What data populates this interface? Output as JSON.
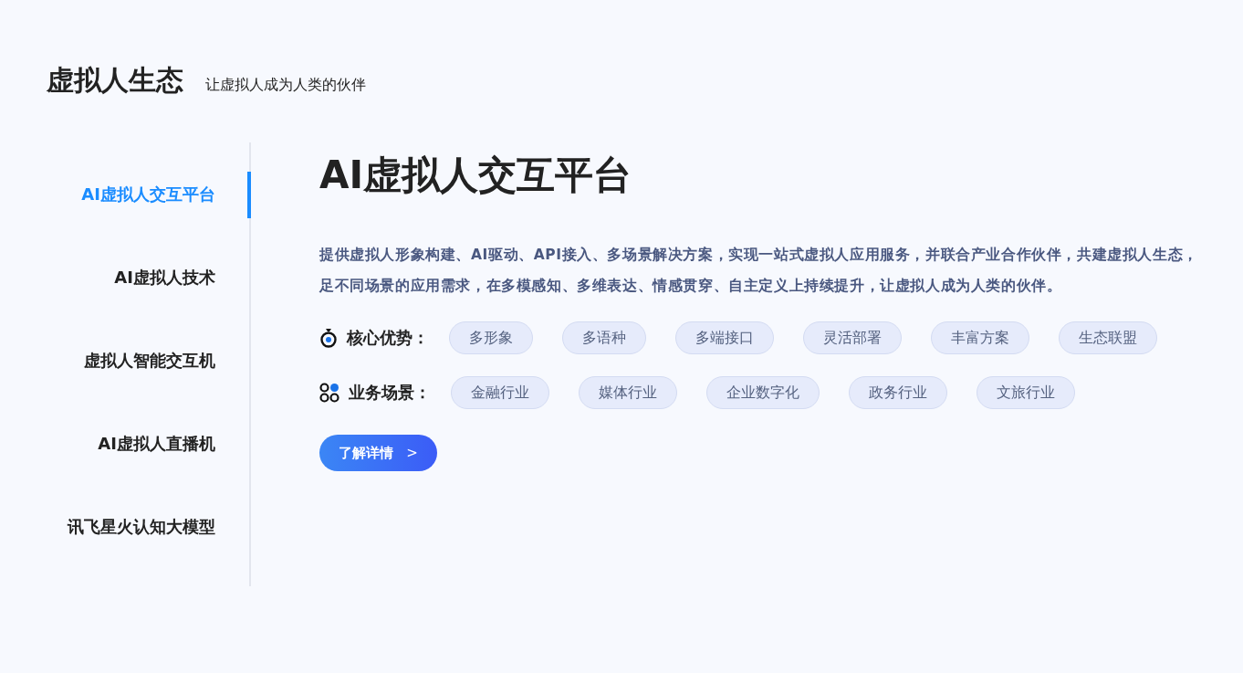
{
  "header": {
    "title": "虚拟人生态",
    "subtitle": "让虚拟人成为人类的伙伴"
  },
  "sidebar": {
    "items": [
      {
        "label": "AI虚拟人交互平台",
        "selected": true
      },
      {
        "label": "AI虚拟人技术",
        "selected": false
      },
      {
        "label": "虚拟人智能交互机",
        "selected": false
      },
      {
        "label": "AI虚拟人直播机",
        "selected": false
      },
      {
        "label": "讯飞星火认知大模型",
        "selected": false
      }
    ]
  },
  "content": {
    "title": "AI虚拟人交互平台",
    "description": [
      "提供虚拟人形象构建、AI驱动、API接入、多场景解决方案，实现一站式虚拟人应用服务，并联合产业合作伙伴，共建虚拟人生态，",
      "足不同场景的应用需求，在多模感知、多维表达、情感贯穿、自主定义上持续提升，让虚拟人成为人类的伙伴。"
    ],
    "tag_groups": [
      {
        "kind": "advantages",
        "label": "核心优势：",
        "tags": [
          "多形象",
          "多语种",
          "多端接口",
          "灵活部署",
          "丰富方案",
          "生态联盟"
        ]
      },
      {
        "kind": "scenarios",
        "label": "业务场景：",
        "tags": [
          "金融行业",
          "媒体行业",
          "企业数字化",
          "政务行业",
          "文旅行业"
        ]
      }
    ],
    "button": {
      "label": "了解详情",
      "arrow": ">"
    }
  }
}
